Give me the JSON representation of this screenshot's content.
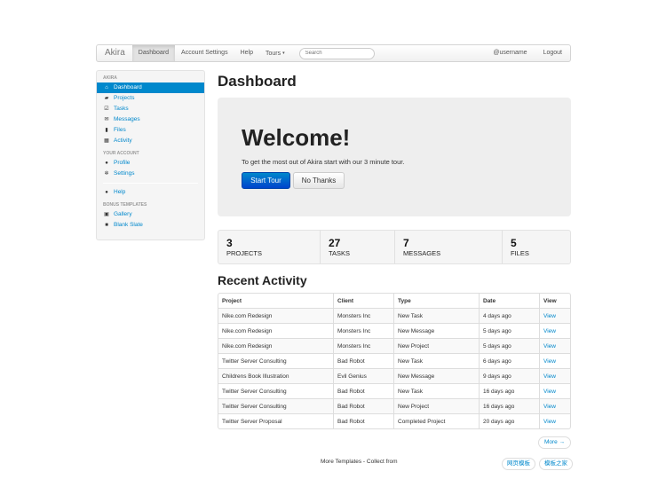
{
  "navbar": {
    "brand": "Akira",
    "items": [
      {
        "label": "Dashboard",
        "active": true
      },
      {
        "label": "Account Settings"
      },
      {
        "label": "Help"
      },
      {
        "label": "Tours"
      }
    ],
    "tours_caret": "▾",
    "search_placeholder": "Search",
    "username": "@username",
    "logout": "Logout"
  },
  "sidebar": {
    "header_main": "Akira",
    "main_items": [
      {
        "label": "Dashboard",
        "icon": "home-icon",
        "glyph": "⌂"
      },
      {
        "label": "Projects",
        "icon": "folder-open-icon",
        "glyph": "▰"
      },
      {
        "label": "Tasks",
        "icon": "check-icon",
        "glyph": "☑"
      },
      {
        "label": "Messages",
        "icon": "envelope-icon",
        "glyph": "✉"
      },
      {
        "label": "Files",
        "icon": "file-icon",
        "glyph": "▮"
      },
      {
        "label": "Activity",
        "icon": "calendar-icon",
        "glyph": "▦"
      }
    ],
    "header_account": "Your Account",
    "account_items": [
      {
        "label": "Profile",
        "icon": "user-icon",
        "glyph": "●"
      },
      {
        "label": "Settings",
        "icon": "cog-icon",
        "glyph": "✲"
      }
    ],
    "help_item": {
      "label": "Help",
      "icon": "info-sign-icon",
      "glyph": "●"
    },
    "header_bonus": "Bonus Templates",
    "bonus_items": [
      {
        "label": "Gallery",
        "icon": "picture-icon",
        "glyph": "▣"
      },
      {
        "label": "Blank Slate",
        "icon": "stop-icon",
        "glyph": "■"
      }
    ]
  },
  "main": {
    "title": "Dashboard",
    "hero": {
      "heading": "Welcome!",
      "text": "To get the most out of Akira start with our 3 minute tour.",
      "primary_btn": "Start Tour",
      "secondary_btn": "No Thanks"
    },
    "stats": [
      {
        "num": "3",
        "label": "PROJECTS"
      },
      {
        "num": "27",
        "label": "TASKS"
      },
      {
        "num": "7",
        "label": "MESSAGES"
      },
      {
        "num": "5",
        "label": "FILES"
      }
    ],
    "activity_title": "Recent Activity",
    "table": {
      "headers": [
        "Project",
        "Client",
        "Type",
        "Date",
        "View"
      ],
      "rows": [
        [
          "Nike.com Redesign",
          "Monsters Inc",
          "New Task",
          "4 days ago",
          "View"
        ],
        [
          "Nike.com Redesign",
          "Monsters Inc",
          "New Message",
          "5 days ago",
          "View"
        ],
        [
          "Nike.com Redesign",
          "Monsters Inc",
          "New Project",
          "5 days ago",
          "View"
        ],
        [
          "Twitter Server Consulting",
          "Bad Robot",
          "New Task",
          "6 days ago",
          "View"
        ],
        [
          "Childrens Book Illustration",
          "Evil Genius",
          "New Message",
          "9 days ago",
          "View"
        ],
        [
          "Twitter Server Consulting",
          "Bad Robot",
          "New Task",
          "16 days ago",
          "View"
        ],
        [
          "Twitter Server Consulting",
          "Bad Robot",
          "New Project",
          "16 days ago",
          "View"
        ],
        [
          "Twitter Server Proposal",
          "Bad Robot",
          "Completed Project",
          "20 days ago",
          "View"
        ]
      ]
    },
    "more_btn": "More →"
  },
  "footer": {
    "text": "More Templates - Collect from",
    "links": [
      "网页模板",
      "模板之家"
    ]
  },
  "colors": {
    "accent": "#0088cc",
    "primary_dark": "#0044cc",
    "hero_bg": "#eeeeee"
  }
}
